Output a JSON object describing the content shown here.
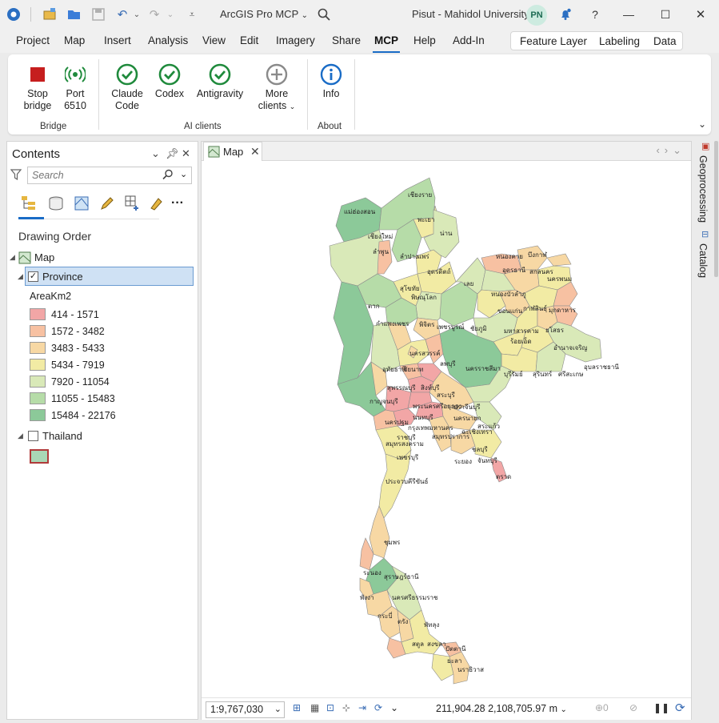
{
  "window": {
    "app_title": "ArcGIS Pro MCP",
    "user": "Pisut - Mahidol University",
    "avatar_initials": "PN"
  },
  "ribbon_tabs": [
    "Project",
    "Map",
    "Insert",
    "Analysis",
    "View",
    "Edit",
    "Imagery",
    "Share",
    "MCP",
    "Help",
    "Add-In"
  ],
  "active_tab": "MCP",
  "contextual_tabs": [
    "Feature Layer",
    "Labeling",
    "Data"
  ],
  "ribbon": {
    "buttons": {
      "stop_bridge": "Stop\nbridge",
      "port": "Port\n6510",
      "claude_code": "Claude\nCode",
      "codex": "Codex",
      "antigravity": "Antigravity",
      "more_clients": "More\nclients",
      "info": "Info"
    },
    "groups": [
      "Bridge",
      "AI clients",
      "About"
    ]
  },
  "contents": {
    "title": "Contents",
    "search_placeholder": "Search",
    "drawing_order": "Drawing Order",
    "map_node": "Map",
    "layer_province": "Province",
    "field_name": "AreaKm2",
    "legend": [
      {
        "label": "414 - 1571",
        "color": "#f2a6a6"
      },
      {
        "label": "1572 - 3482",
        "color": "#f7c1a2"
      },
      {
        "label": "3483 - 5433",
        "color": "#f7d8a4"
      },
      {
        "label": "5434 - 7919",
        "color": "#f2eba4"
      },
      {
        "label": "7920 - 11054",
        "color": "#d9e9b8"
      },
      {
        "label": "11055 - 15483",
        "color": "#b6dca8"
      },
      {
        "label": "15484 - 22176",
        "color": "#8cc999"
      }
    ],
    "layer_thailand": "Thailand",
    "thailand_swatch": {
      "fill": "#a9d7b5",
      "outline": "#b03a3a"
    }
  },
  "map": {
    "tab_title": "Map",
    "scale": "1:9,767,030",
    "coordinates": "211,904.28 2,108,705.97 m",
    "labels": [
      "เชียงราย",
      "แม่ฮ่องสอน",
      "พะเยา",
      "น่าน",
      "เชียงใหม่",
      "ลำพูน",
      "ลำปาง",
      "แพร่",
      "อุตรดิตถ์",
      "หนองคาย",
      "บึงกาฬ",
      "อุดรธานี",
      "สกลนคร",
      "นครพนม",
      "สุโขทัย",
      "เลย",
      "หนองบัวลำภู",
      "พิษณุโลก",
      "ขอนแก่น",
      "กาฬสินธุ์",
      "มุกดาหาร",
      "ตาก",
      "กำแพงเพชร",
      "พิจิตร",
      "เพชรบูรณ์",
      "ชัยภูมิ",
      "มหาสารคาม",
      "ร้อยเอ็ด",
      "ยโสธร",
      "อำนาจเจริญ",
      "นครสวรรค์",
      "อุทัยธานี",
      "ชัยนาท",
      "ลพบุรี",
      "นครราชสีมา",
      "บุรีรัมย์",
      "สุรินทร์",
      "ศรีสะเกษ",
      "อุบลราชธานี",
      "สุพรรณบุรี",
      "สิงห์บุรี",
      "สระบุรี",
      "กาญจนบุรี",
      "พระนครศรีอยุธยา",
      "ปราจีนบุรี",
      "นครปฐม",
      "นนทบุรี",
      "นครนายก",
      "กรุงเทพมหานคร",
      "ฉะเชิงเทรา",
      "สระแก้ว",
      "ราชบุรี",
      "สมุทรปราการ",
      "สมุทรสงคราม",
      "ชลบุรี",
      "เพชรบุรี",
      "ระยอง",
      "จันทบุรี",
      "ตราด",
      "ประจวบคีรีขันธ์",
      "ชุมพร",
      "ระนอง",
      "สุราษฎร์ธานี",
      "พังงา",
      "นครศรีธรรมราช",
      "กระบี่",
      "ตรัง",
      "พัทลุง",
      "สตูล",
      "สงขลา",
      "ปัตตานี",
      "ยะลา",
      "นราธิวาส"
    ]
  },
  "side_tabs": [
    "Geoprocessing",
    "Catalog"
  ]
}
